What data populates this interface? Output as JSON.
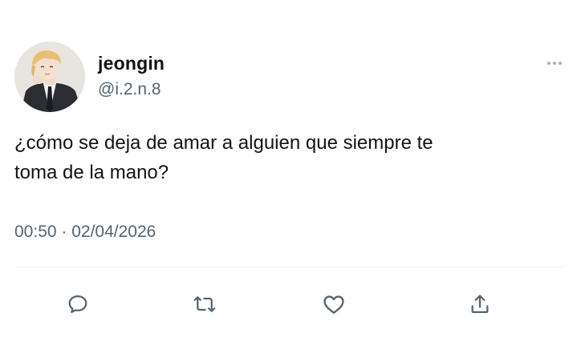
{
  "author": {
    "display_name": "jeongin",
    "handle": "@i.2.n.8",
    "avatar_icon": "profile-photo"
  },
  "tweet": {
    "text": "¿cómo se deja de amar a alguien que siempre te\ntoma de la mano?",
    "timestamp": "00:50 · 02/04/2026"
  },
  "actions": [
    {
      "name": "reply",
      "icon": "speech-bubble-icon"
    },
    {
      "name": "retweet",
      "icon": "retweet-arrows-icon"
    },
    {
      "name": "like",
      "icon": "heart-icon"
    },
    {
      "name": "share",
      "icon": "upload-share-icon"
    }
  ],
  "colors": {
    "text": "#0f1419",
    "secondary": "#536471",
    "divider": "#eff3f4",
    "icon": "#536471"
  }
}
